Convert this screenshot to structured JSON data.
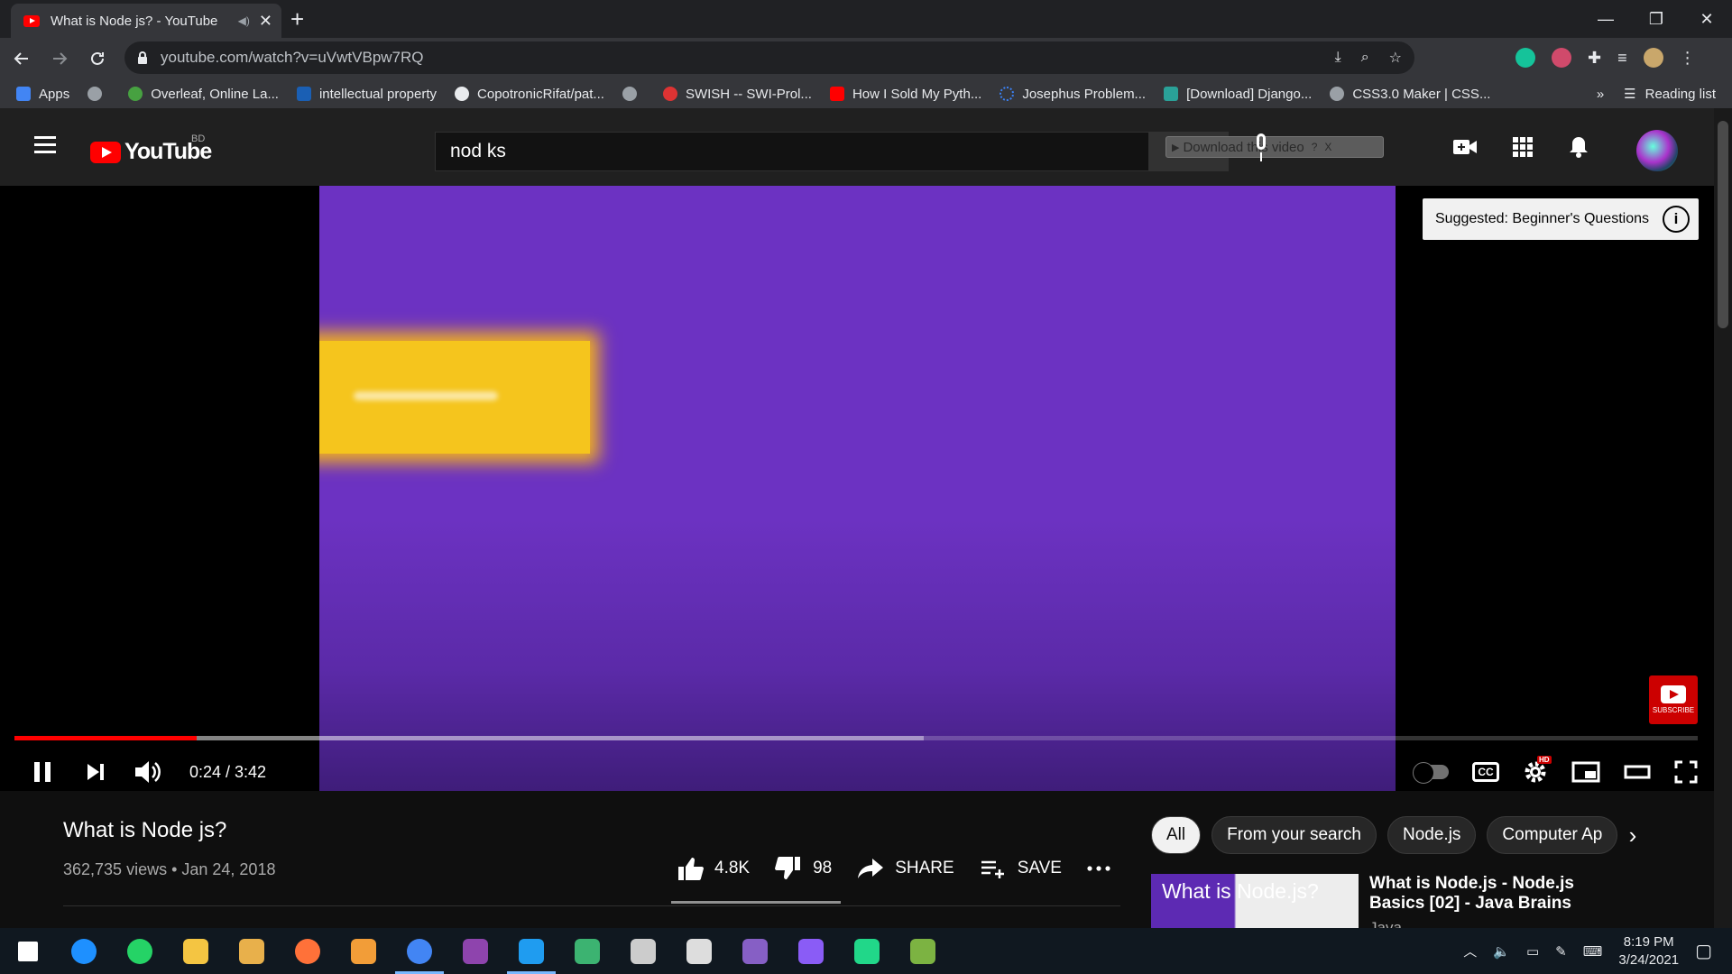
{
  "browser": {
    "tab_title": "What is Node js? - YouTube",
    "tab_close": "✕",
    "new_tab": "+",
    "url": "youtube.com/watch?v=uVwtVBpw7RQ",
    "window_controls": [
      "—",
      "❐",
      "✕"
    ]
  },
  "bookmarks": {
    "items": [
      {
        "label": "Apps",
        "color": "#4285f4"
      },
      {
        "label": "",
        "color": "#9aa0a6"
      },
      {
        "label": "Overleaf, Online La...",
        "color": "#47a141"
      },
      {
        "label": "intellectual property",
        "color": "#1a5fb4"
      },
      {
        "label": "CopotronicRifat/pat...",
        "color": "#e8eaed"
      },
      {
        "label": "",
        "color": "#9aa0a6"
      },
      {
        "label": "SWISH -- SWI-Prol...",
        "color": "#d33"
      },
      {
        "label": "How I Sold My Pyth...",
        "color": "#ff0000"
      },
      {
        "label": "Josephus Problem...",
        "color": "#3b82f6"
      },
      {
        "label": "[Download] Django...",
        "color": "#2aa198"
      },
      {
        "label": "CSS3.0 Maker | CSS...",
        "color": "#9aa0a6"
      }
    ],
    "more": "»",
    "reading_list": "Reading list"
  },
  "youtube": {
    "logo_text": "YouTube",
    "country_code": "BD",
    "search_value": "nod ks",
    "download_overlay": "Download this video",
    "download_help": "?",
    "download_close": "X"
  },
  "player": {
    "suggested_card": "Suggested: Beginner's Questions",
    "info": "i",
    "subscribe_badge": "SUBSCRIBE",
    "time_display": "0:24 / 3:42",
    "played_fraction": 0.108,
    "buffered_fraction": 0.54,
    "cc_label": "CC",
    "hd_badge": "HD"
  },
  "video_info": {
    "title": "What is Node js?",
    "meta": "362,735 views • Jan 24, 2018",
    "likes": "4.8K",
    "dislikes": "98",
    "share_label": "SHARE",
    "save_label": "SAVE"
  },
  "chips": [
    "All",
    "From your search",
    "Node.js",
    "Computer Ap"
  ],
  "recommendation": {
    "thumb_text": "What is Node.js?",
    "title": "What is Node.js - Node.js Basics [02] - Java Brains",
    "channel": "Java Brains"
  },
  "taskbar": {
    "apps": [
      {
        "name": "start",
        "color": "#ffffff"
      },
      {
        "name": "search",
        "color": "#1e90ff"
      },
      {
        "name": "whatsapp",
        "color": "#25d366"
      },
      {
        "name": "file-explorer",
        "color": "#f4c542"
      },
      {
        "name": "app-4",
        "color": "#e8b04b"
      },
      {
        "name": "firefox",
        "color": "#ff7139"
      },
      {
        "name": "app-6",
        "color": "#f29d38"
      },
      {
        "name": "chrome",
        "color": "#4285f4"
      },
      {
        "name": "github-desktop",
        "color": "#8e44ad"
      },
      {
        "name": "vscode",
        "color": "#1f9cf0"
      },
      {
        "name": "app-10",
        "color": "#3cb371"
      },
      {
        "name": "app-11",
        "color": "#cccccc"
      },
      {
        "name": "app-12",
        "color": "#dddddd"
      },
      {
        "name": "visual-studio",
        "color": "#865fc5"
      },
      {
        "name": "messenger",
        "color": "#8a5cf6"
      },
      {
        "name": "pycharm",
        "color": "#21d789"
      },
      {
        "name": "app-16",
        "color": "#7cb342"
      }
    ],
    "time": "8:19 PM",
    "date": "3/24/2021"
  },
  "colors": {
    "video_bg": "#6c32c2",
    "accent_red": "#ff0000"
  }
}
